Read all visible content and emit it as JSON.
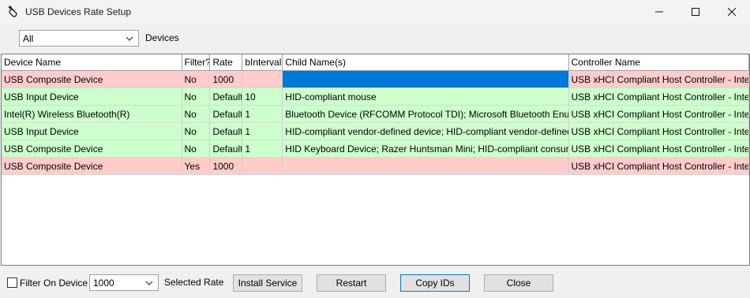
{
  "window": {
    "title": "USB Devices Rate Setup",
    "minimize_icon": "minimize-icon",
    "maximize_icon": "maximize-icon",
    "close_icon": "close-icon"
  },
  "toolbar": {
    "filter_value": "All",
    "filter_label": "Devices"
  },
  "table": {
    "columns": [
      "Device Name",
      "Filter?",
      "Rate",
      "bInterval",
      "Child Name(s)",
      "Controller Name"
    ],
    "rows": [
      {
        "status": "red",
        "cells": [
          "USB Composite Device",
          "No",
          "1000",
          "",
          "",
          "USB xHCI Compliant Host Controller - Intel(R) USB"
        ]
      },
      {
        "status": "green",
        "cells": [
          "USB Input Device",
          "No",
          "Default",
          "10",
          "HID-compliant mouse",
          "USB xHCI Compliant Host Controller - Intel(R) USB"
        ]
      },
      {
        "status": "green",
        "cells": [
          "Intel(R) Wireless Bluetooth(R)",
          "No",
          "Default",
          "1",
          "Bluetooth Device (RFCOMM Protocol TDI); Microsoft Bluetooth Enumerator; Microsoft Bluetooth LE Enumerator",
          "USB xHCI Compliant Host Controller - Intel(R) USB"
        ]
      },
      {
        "status": "green",
        "cells": [
          "USB Input Device",
          "No",
          "Default",
          "1",
          "HID-compliant vendor-defined device; HID-compliant vendor-defined device",
          "USB xHCI Compliant Host Controller - Intel(R) USB"
        ]
      },
      {
        "status": "green",
        "cells": [
          "USB Composite Device",
          "No",
          "Default",
          "1",
          "HID Keyboard Device; Razer Huntsman Mini; HID-compliant consumer control device",
          "USB xHCI Compliant Host Controller - Intel(R) USB"
        ]
      },
      {
        "status": "red",
        "cells": [
          "USB Composite Device",
          "Yes",
          "1000",
          "",
          "",
          "USB xHCI Compliant Host Controller - Intel(R) USB"
        ]
      }
    ]
  },
  "bottom": {
    "filter_on_device_label": "Filter On Device",
    "rate_value": "1000",
    "selected_rate_label": "Selected Rate",
    "install_service_label": "Install Service",
    "restart_label": "Restart",
    "copy_ids_label": "Copy IDs",
    "close_label": "Close"
  },
  "colors": {
    "row_red": "#ffcccc",
    "row_green": "#ccffcc",
    "selection": "#0078d7"
  }
}
